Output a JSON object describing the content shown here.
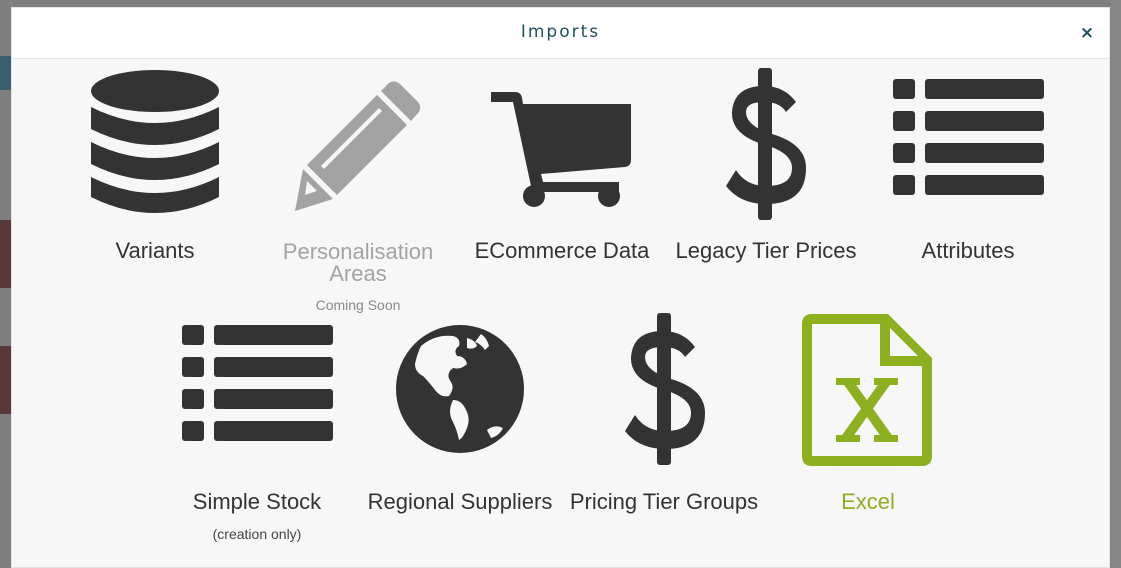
{
  "modal": {
    "title": "Imports",
    "close_glyph": "×"
  },
  "tiles": [
    {
      "label": "Variants",
      "icon": "database-icon",
      "status": "active"
    },
    {
      "label": "Personalisation Areas",
      "label_line1": "Personalisation",
      "label_line2": "Areas",
      "sub": "Coming Soon",
      "icon": "pencil-icon",
      "status": "disabled"
    },
    {
      "label": "ECommerce Data",
      "icon": "shopping-cart-icon",
      "status": "active"
    },
    {
      "label": "Legacy Tier Prices",
      "icon": "dollar-icon",
      "status": "active"
    },
    {
      "label": "Attributes",
      "icon": "list-icon",
      "status": "active"
    },
    {
      "label": "Simple Stock",
      "sub": "(creation only)",
      "icon": "list-icon",
      "status": "active"
    },
    {
      "label": "Regional Suppliers",
      "icon": "globe-icon",
      "status": "active"
    },
    {
      "label": "Pricing Tier Groups",
      "icon": "dollar-icon",
      "status": "active"
    },
    {
      "label": "Excel",
      "icon": "excel-file-icon",
      "status": "highlighted"
    }
  ],
  "colors": {
    "icon": "#333333",
    "disabled": "#a3a3a3",
    "accent": "#8db021",
    "title": "#1f4f5e"
  }
}
